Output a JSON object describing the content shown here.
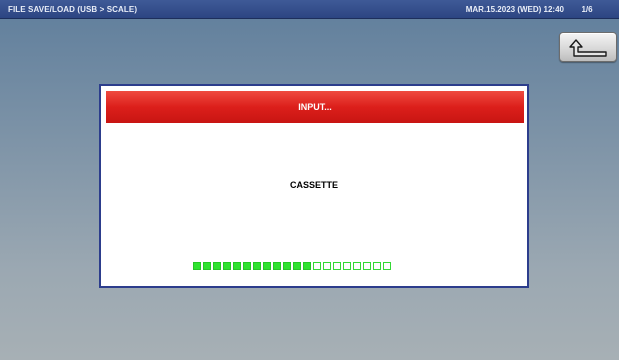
{
  "header": {
    "title": "FILE SAVE/LOAD (USB > SCALE)",
    "datetime": "MAR.15.2023 (WED)  12:40",
    "page_indicator": "1/6"
  },
  "back_button": {
    "icon": "return-arrow-icon"
  },
  "dialog": {
    "title": "INPUT...",
    "message": "CASSETTE",
    "progress": {
      "filled_segments": 12,
      "total_segments": 20,
      "fraction": 0.6
    }
  },
  "colors": {
    "title_bar": "#2f4a8a",
    "dialog_header": "#dc1f1b",
    "dialog_border": "#2c3d8c",
    "progress_fill": "#2fe32f"
  }
}
